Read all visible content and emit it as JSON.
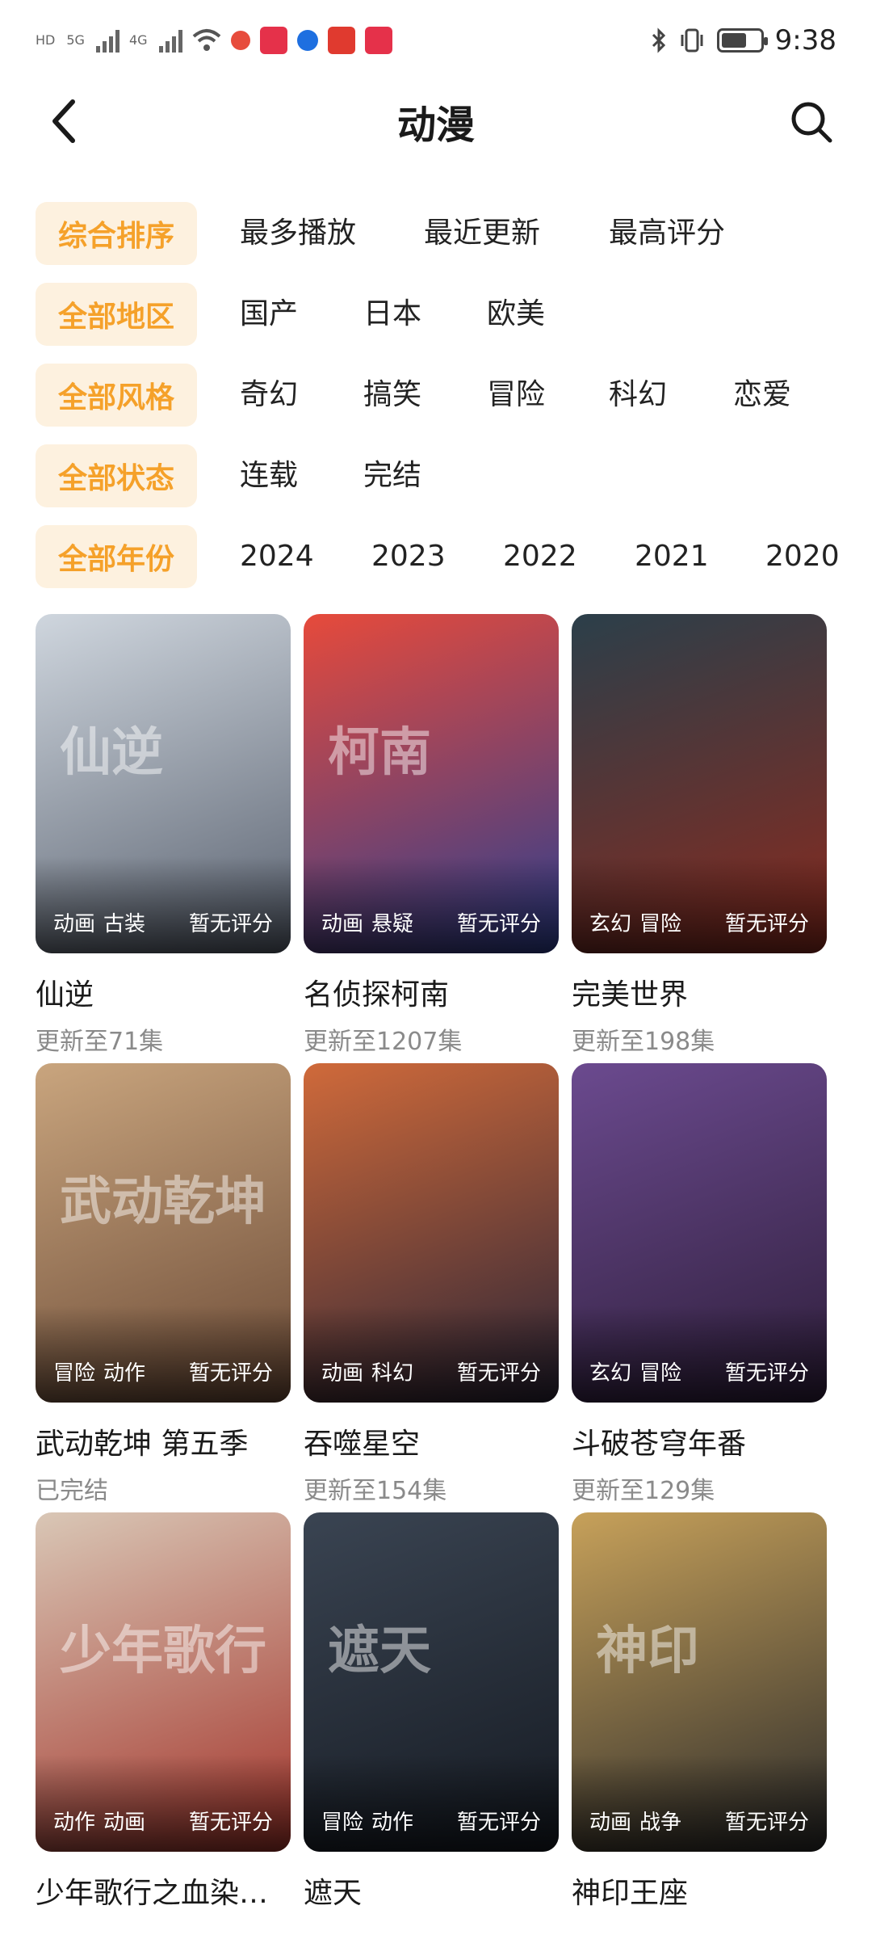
{
  "status_bar": {
    "time": "9:38",
    "left_labels": [
      "HD",
      "5G",
      "4G"
    ],
    "battery_level": 0.65
  },
  "header": {
    "title": "动漫"
  },
  "filters": [
    {
      "active": "综合排序",
      "options": [
        "最多播放",
        "最近更新",
        "最高评分"
      ]
    },
    {
      "active": "全部地区",
      "options": [
        "国产",
        "日本",
        "欧美"
      ]
    },
    {
      "active": "全部风格",
      "options": [
        "奇幻",
        "搞笑",
        "冒险",
        "科幻",
        "恋爱"
      ]
    },
    {
      "active": "全部状态",
      "options": [
        "连载",
        "完结"
      ]
    },
    {
      "active": "全部年份",
      "options": [
        "2024",
        "2023",
        "2022",
        "2021",
        "2020"
      ]
    }
  ],
  "items": [
    {
      "title": "仙逆",
      "subtitle": "更新至71集",
      "tags": [
        "动画",
        "古装"
      ],
      "score": "暂无评分",
      "deco": "仙逆",
      "colors": [
        "#cfd6de",
        "#5a6270"
      ]
    },
    {
      "title": "名侦探柯南",
      "subtitle": "更新至1207集",
      "tags": [
        "动画",
        "悬疑"
      ],
      "score": "暂无评分",
      "deco": "柯南",
      "colors": [
        "#e74a3b",
        "#2c3e8f"
      ]
    },
    {
      "title": "完美世界",
      "subtitle": "更新至198集",
      "tags": [
        "玄幻",
        "冒险"
      ],
      "score": "暂无评分",
      "deco": "",
      "colors": [
        "#2b3f4a",
        "#8a2a1e"
      ]
    },
    {
      "title": "武动乾坤 第五季",
      "subtitle": "已完结",
      "tags": [
        "冒险",
        "动作"
      ],
      "score": "暂无评分",
      "deco": "武动乾坤",
      "colors": [
        "#c9a57e",
        "#6b4a36"
      ]
    },
    {
      "title": "吞噬星空",
      "subtitle": "更新至154集",
      "tags": [
        "动画",
        "科幻"
      ],
      "score": "暂无评分",
      "deco": "",
      "colors": [
        "#d06a3a",
        "#2a2436"
      ]
    },
    {
      "title": "斗破苍穹年番",
      "subtitle": "更新至129集",
      "tags": [
        "玄幻",
        "冒险"
      ],
      "score": "暂无评分",
      "deco": "",
      "colors": [
        "#6b4a8f",
        "#2e1e3a"
      ]
    },
    {
      "title": "少年歌行之血染…",
      "subtitle": "",
      "tags": [
        "动作",
        "动画"
      ],
      "score": "暂无评分",
      "deco": "少年歌行",
      "colors": [
        "#d9c7b6",
        "#a3332a"
      ]
    },
    {
      "title": "遮天",
      "subtitle": "",
      "tags": [
        "冒险",
        "动作"
      ],
      "score": "暂无评分",
      "deco": "遮天",
      "colors": [
        "#3a4452",
        "#151a22"
      ]
    },
    {
      "title": "神印王座",
      "subtitle": "",
      "tags": [
        "动画",
        "战争"
      ],
      "score": "暂无评分",
      "deco": "神印",
      "colors": [
        "#c7a15a",
        "#2a2a2a"
      ]
    }
  ]
}
